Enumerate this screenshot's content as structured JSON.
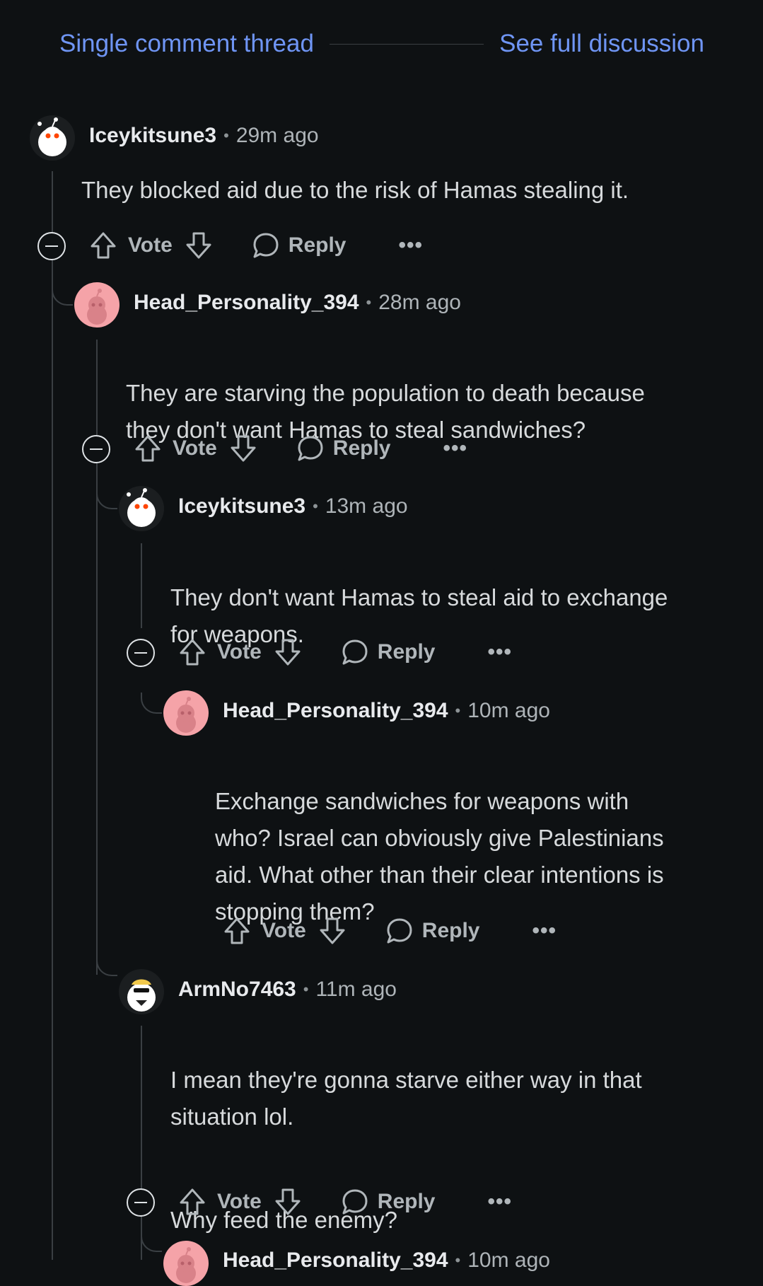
{
  "header": {
    "single_thread": "Single comment thread",
    "full_discussion": "See full discussion"
  },
  "labels": {
    "vote": "Vote",
    "reply": "Reply",
    "more": "•••",
    "separator": "•"
  },
  "comments": [
    {
      "user": "Iceykitsune3",
      "time": "29m ago",
      "avatar": "snoo-white-icon",
      "paragraphs": [
        "They blocked aid due to the risk of Hamas stealing it."
      ]
    },
    {
      "user": "Head_Personality_394",
      "time": "28m ago",
      "avatar": "snoo-pink-icon",
      "paragraphs": [
        "They are starving the population to death because\nthey don't want Hamas to steal sandwiches?"
      ]
    },
    {
      "user": "Iceykitsune3",
      "time": "13m ago",
      "avatar": "snoo-white-icon",
      "paragraphs": [
        "They don't want Hamas to steal aid to exchange\nfor weapons."
      ]
    },
    {
      "user": "Head_Personality_394",
      "time": "10m ago",
      "avatar": "snoo-pink-icon",
      "paragraphs": [
        "Exchange sandwiches for weapons with\nwho? Israel can obviously give Palestinians\naid. What other than their clear intentions is\nstopping them?"
      ]
    },
    {
      "user": "ArmNo7463",
      "time": "11m ago",
      "avatar": "snoo-sunglasses-icon",
      "paragraphs": [
        "I mean they're gonna starve either way in that\nsituation lol.",
        "Why feed the enemy?"
      ]
    },
    {
      "user": "Head_Personality_394",
      "time": "10m ago",
      "avatar": "snoo-pink-icon",
      "paragraphs": []
    }
  ],
  "colors": {
    "background": "#0e1113",
    "link": "#6f95f4",
    "avatar_pink": "#f5a3a8"
  }
}
